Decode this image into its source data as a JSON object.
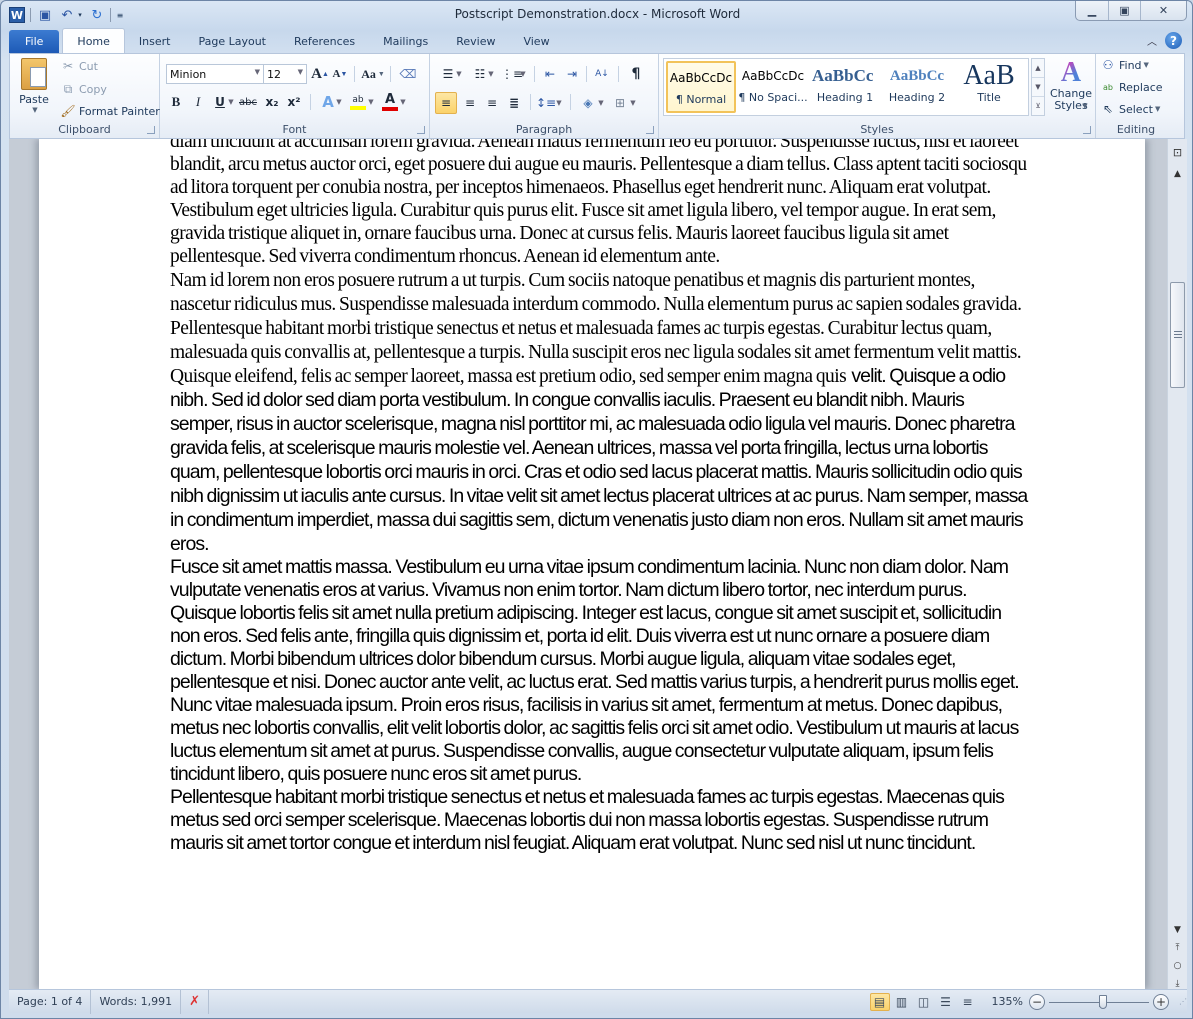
{
  "window": {
    "title": "Postscript Demonstration.docx  -  Microsoft Word",
    "app_icon": "W",
    "controls": {
      "minimize": "minimize-icon",
      "maximize": "restore-icon",
      "close": "close-icon"
    }
  },
  "quick_access": [
    {
      "name": "save",
      "icon": "save-icon"
    },
    {
      "name": "undo",
      "icon": "undo-icon"
    },
    {
      "name": "redo",
      "icon": "redo-icon"
    },
    {
      "name": "customize",
      "icon": "customize-icon"
    }
  ],
  "tabs": [
    {
      "label": "File",
      "active": false
    },
    {
      "label": "Home",
      "active": true
    },
    {
      "label": "Insert",
      "active": false
    },
    {
      "label": "Page Layout",
      "active": false
    },
    {
      "label": "References",
      "active": false
    },
    {
      "label": "Mailings",
      "active": false
    },
    {
      "label": "Review",
      "active": false
    },
    {
      "label": "View",
      "active": false
    }
  ],
  "ribbon": {
    "clipboard": {
      "label": "Clipboard",
      "paste": "Paste",
      "cut": "Cut",
      "copy": "Copy",
      "format_painter": "Format Painter"
    },
    "font": {
      "label": "Font",
      "font_name": "Minion",
      "font_size": "12",
      "bold": "B",
      "italic": "I",
      "underline": "U",
      "strikethrough": "abc",
      "subscript": "x₂",
      "superscript": "x²",
      "change_case": "Aa",
      "highlight_color": "#ffff00",
      "font_color": "#e00000"
    },
    "paragraph": {
      "label": "Paragraph",
      "pilcrow": "¶"
    },
    "styles": {
      "label": "Styles",
      "items": [
        {
          "sample": "AaBbCcDc",
          "name": "¶ Normal",
          "selected": true
        },
        {
          "sample": "AaBbCcDc",
          "name": "¶ No Spaci...",
          "selected": false
        },
        {
          "sample": "AaBbCc",
          "name": "Heading 1",
          "selected": false
        },
        {
          "sample": "AaBbCc",
          "name": "Heading 2",
          "selected": false
        },
        {
          "sample": "AaB",
          "name": "Title",
          "selected": false
        }
      ],
      "change_styles": "Change Styles"
    },
    "editing": {
      "label": "Editing",
      "find": "Find",
      "replace": "Replace",
      "select": "Select"
    }
  },
  "document": {
    "paragraphs": [
      {
        "font": "serif",
        "text": "diam tincidunt at accumsan lorem gravida. Aenean mattis fermentum leo eu porttitor. Suspendisse luctus, nisl et laoreet blandit, arcu metus auctor orci, eget posuere dui augue eu mauris. Pellentesque a diam tellus. Class aptent taciti sociosqu ad litora torquent per conubia nostra, per inceptos himenaeos. Phasellus eget hendrerit nunc. Aliquam erat volutpat. Vestibulum eget ultricies ligula. Curabitur quis purus elit. Fusce sit amet ligula libero, vel tempor augue. In erat sem, gravida tristique aliquet in, ornare faucibus urna. Donec at cursus felis. Mauris laoreet faucibus ligula sit amet pellentesque. Sed viverra condimentum rhoncus. Aenean id elementum ante."
      },
      {
        "font": "mixed",
        "text_serif": "Nam id lorem non eros posuere rutrum a ut turpis. Cum sociis natoque penatibus et magnis dis parturient montes, nascetur ridiculus mus. Suspendisse malesuada interdum commodo. Nulla elementum purus ac sapien sodales gravida. Pellentesque habitant morbi tristique senectus et netus et malesuada fames ac turpis egestas. Curabitur lectus quam, malesuada quis convallis at, pellentesque a turpis. Nulla suscipit eros nec ligula sodales sit amet fermentum velit mattis. Quisque eleifend, felis ac semper laoreet, massa est pretium odio, sed semper enim magna quis",
        "text_sans": "velit. Quisque a odio nibh. Sed id dolor sed diam porta vestibulum. In congue convallis iaculis. Praesent eu blandit nibh. Mauris semper, risus in auctor scelerisque, magna nisl porttitor mi, ac malesuada odio ligula vel mauris. Donec pharetra gravida felis, at scelerisque mauris molestie vel. Aenean ultrices, massa vel porta fringilla, lectus urna lobortis quam, pellentesque lobortis orci mauris in orci. Cras et odio sed lacus placerat mattis. Mauris sollicitudin odio quis nibh dignissim ut iaculis ante cursus. In vitae velit sit amet lectus placerat ultrices at ac purus. Nam semper, massa in condimentum imperdiet, massa dui sagittis sem, dictum venenatis justo diam non eros. Nullam sit amet mauris eros."
      },
      {
        "font": "sans",
        "text": "Fusce sit amet mattis massa. Vestibulum eu urna vitae ipsum condimentum lacinia. Nunc non diam dolor. Nam vulputate venenatis eros at varius. Vivamus non enim tortor. Nam dictum libero tortor, nec interdum purus. Quisque lobortis felis sit amet nulla pretium adipiscing. Integer est lacus, congue sit amet suscipit et, sollicitudin non eros. Sed felis ante, fringilla quis dignissim et, porta id elit. Duis viverra est ut nunc ornare a posuere diam dictum. Morbi bibendum ultrices dolor bibendum cursus. Morbi augue ligula, aliquam vitae sodales eget, pellentesque et nisi. Donec auctor ante velit, ac luctus erat. Sed mattis varius turpis, a hendrerit purus mollis eget. Nunc vitae malesuada ipsum. Proin eros risus, facilisis in varius sit amet, fermentum at metus. Donec dapibus, metus nec lobortis convallis, elit velit lobortis dolor, ac sagittis felis orci sit amet odio. Vestibulum ut mauris at lacus luctus elementum sit amet at purus. Suspendisse convallis, augue consectetur vulputate aliquam, ipsum felis tincidunt libero, quis posuere nunc eros sit amet purus."
      },
      {
        "font": "sans",
        "text": "Pellentesque habitant morbi tristique senectus et netus et malesuada fames ac turpis egestas. Maecenas quis metus sed orci semper scelerisque. Maecenas lobortis dui non massa lobortis egestas. Suspendisse rutrum mauris sit amet tortor congue et interdum nisl feugiat. Aliquam erat volutpat. Nunc sed nisl ut nunc tincidunt."
      }
    ]
  },
  "statusbar": {
    "page": "Page: 1 of 4",
    "words": "Words: 1,991",
    "proofing_icon": "proofing-error-icon",
    "zoom_level": "135%",
    "zoom_percent": 135,
    "active_view": "print-layout"
  },
  "scrollbar": {
    "position_fraction": 0.08
  }
}
